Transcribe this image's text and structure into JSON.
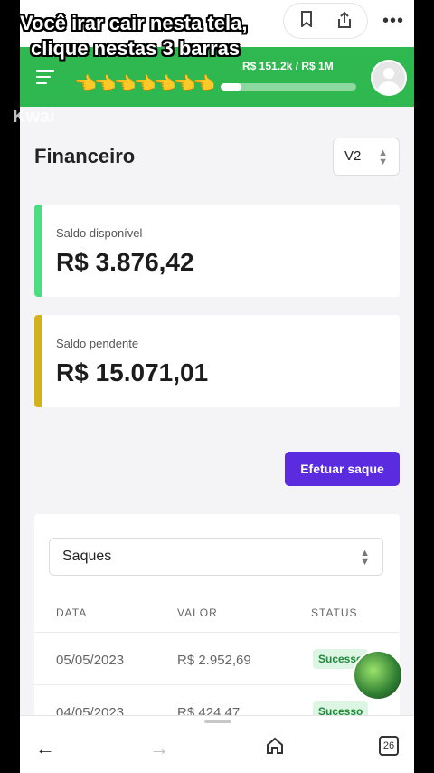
{
  "overlay": {
    "caption_line1": "Você irar cair nesta tela,",
    "caption_line2": "clique nestas 3 barras",
    "pointing_hands": "👈👈👈👈👈👈👈",
    "watermark": "Kwai"
  },
  "browser": {
    "tabs_count": "26",
    "icons": [
      "bookmark-icon",
      "share-icon",
      "more-icon",
      "back-arrow-icon",
      "forward-arrow-icon",
      "home-icon",
      "tabs-icon"
    ]
  },
  "header": {
    "goal_text": "R$ 151.2k / R$ 1M",
    "goal_progress": 0.15,
    "color": "#2fb84f"
  },
  "page": {
    "title": "Financeiro",
    "version": "V2"
  },
  "balances": [
    {
      "label": "Saldo disponível",
      "amount": "R$ 3.876,42",
      "color": "#4ade80"
    },
    {
      "label": "Saldo pendente",
      "amount": "R$ 15.071,01",
      "color": "#d4b219"
    }
  ],
  "withdraw_button": "Efetuar saque",
  "withdrawals": {
    "filter": "Saques",
    "columns": [
      "DATA",
      "VALOR",
      "STATUS"
    ],
    "rows": [
      {
        "date": "05/05/2023",
        "value": "R$ 2.952,69",
        "status": "Sucesso"
      },
      {
        "date": "04/05/2023",
        "value": "R$ 424,47",
        "status": "Sucesso"
      }
    ]
  }
}
